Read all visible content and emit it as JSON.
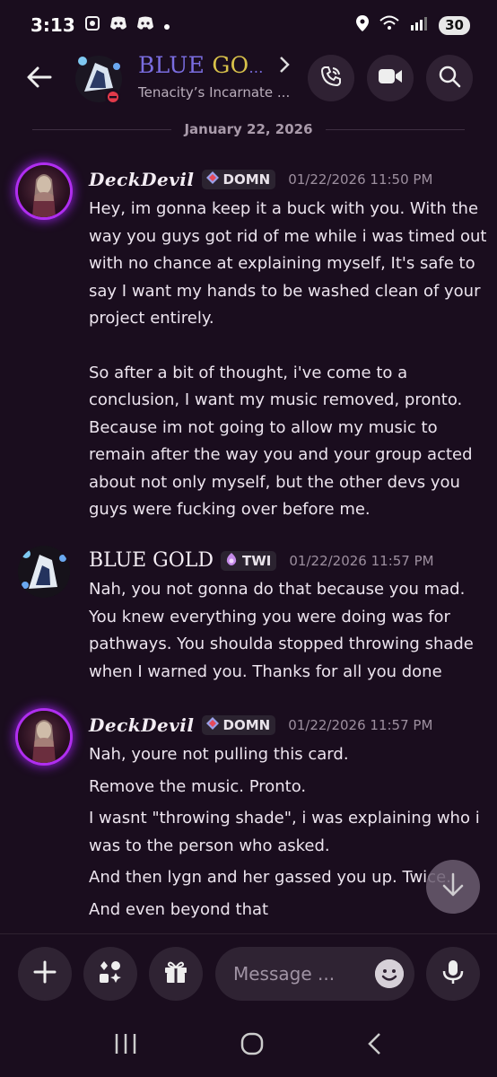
{
  "status_bar": {
    "time": "3:13",
    "battery": "30"
  },
  "header": {
    "title_blue": "BLUE",
    "title_gold": "GO",
    "title_ellipsis": "...",
    "subtitle": "Tenacity’s Incarnate ..."
  },
  "date_separator": "January 22, 2026",
  "messages": [
    {
      "author": "DeckDevil",
      "tag": "DOMN",
      "timestamp": "01/22/2026 11:50 PM",
      "paragraphs": [
        "Hey, im gonna keep it a buck with you. With the way you guys got rid of me while i was timed out with no chance at explaining myself, It's safe to say I want my hands to be washed clean of your project entirely.",
        "So after a bit of thought, i've come to a conclusion, I want my music removed, pronto. Because im not going to allow my music to remain after the way you and your group acted about not only myself, but the other devs you guys were fucking over before me."
      ]
    },
    {
      "author": "BLUE GOLD",
      "tag": "TWI",
      "timestamp": "01/22/2026 11:57 PM",
      "paragraphs": [
        "Nah, you not gonna do that because you mad. You knew everything you were doing was for pathways. You shoulda stopped throwing shade when I warned you. Thanks for all you done"
      ]
    },
    {
      "author": "DeckDevil",
      "tag": "DOMN",
      "timestamp": "01/22/2026 11:57 PM",
      "paragraphs": [
        "Nah,  youre not pulling this card.",
        "Remove the music. Pronto.",
        "I wasnt \"throwing shade\", i was explaining who i was to the person who asked.",
        "And then lygn and her gassed you up. Twice.",
        "And even beyond that"
      ]
    }
  ],
  "composer": {
    "placeholder": "Message ..."
  },
  "colors": {
    "background": "#1a0d1e",
    "title_blue": "#7a6de0",
    "title_gold": "#d8c14a",
    "avatar_glow": "#b02ef0"
  },
  "icons": [
    "back-arrow-icon",
    "chevron-right-icon",
    "phone-call-icon",
    "video-camera-icon",
    "search-icon",
    "plus-icon",
    "apps-icon",
    "gift-icon",
    "emoji-icon",
    "microphone-icon",
    "scroll-down-icon"
  ]
}
